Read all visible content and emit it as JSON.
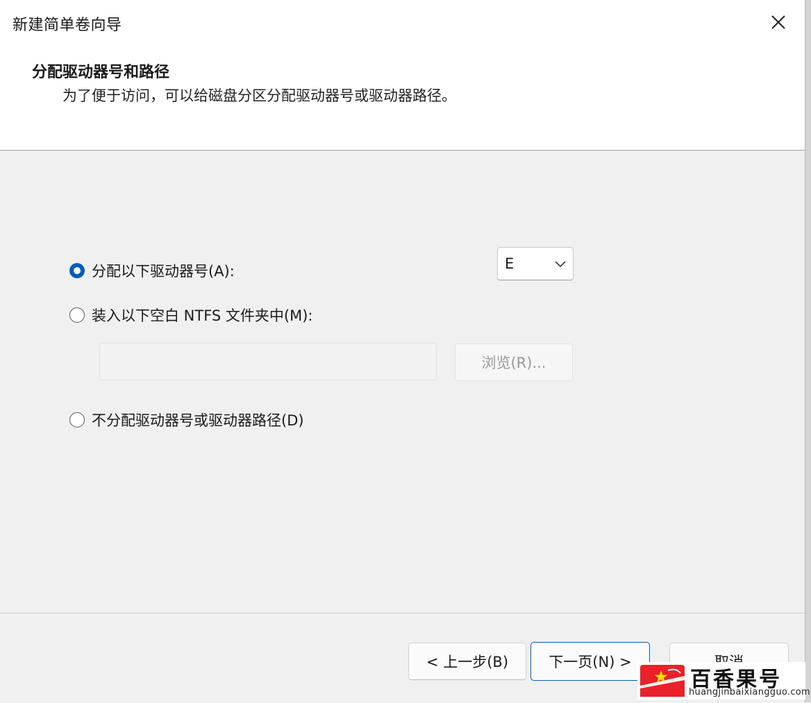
{
  "window": {
    "title": "新建简单卷向导"
  },
  "header": {
    "title": "分配驱动器号和路径",
    "subtitle": "为了便于访问，可以给磁盘分区分配驱动器号或驱动器路径。"
  },
  "options": {
    "assign_letter": {
      "label": "分配以下驱动器号(A):",
      "selected": true
    },
    "mount_folder": {
      "label": "装入以下空白 NTFS 文件夹中(M):",
      "selected": false
    },
    "no_assign": {
      "label": "不分配驱动器号或驱动器路径(D)",
      "selected": false
    }
  },
  "drive_letter": {
    "value": "E"
  },
  "folder_path": {
    "value": ""
  },
  "browse": {
    "label": "浏览(R)..."
  },
  "buttons": {
    "back": "< 上一步(B)",
    "next": "下一页(N) >",
    "cancel": "取消"
  },
  "watermark": {
    "name": "百香果号",
    "url": "huangjinbaixiangguo.com"
  },
  "colors": {
    "accent": "#005fb8",
    "disabled_text": "#9a9a9a",
    "watermark_red": "#e8212a"
  }
}
